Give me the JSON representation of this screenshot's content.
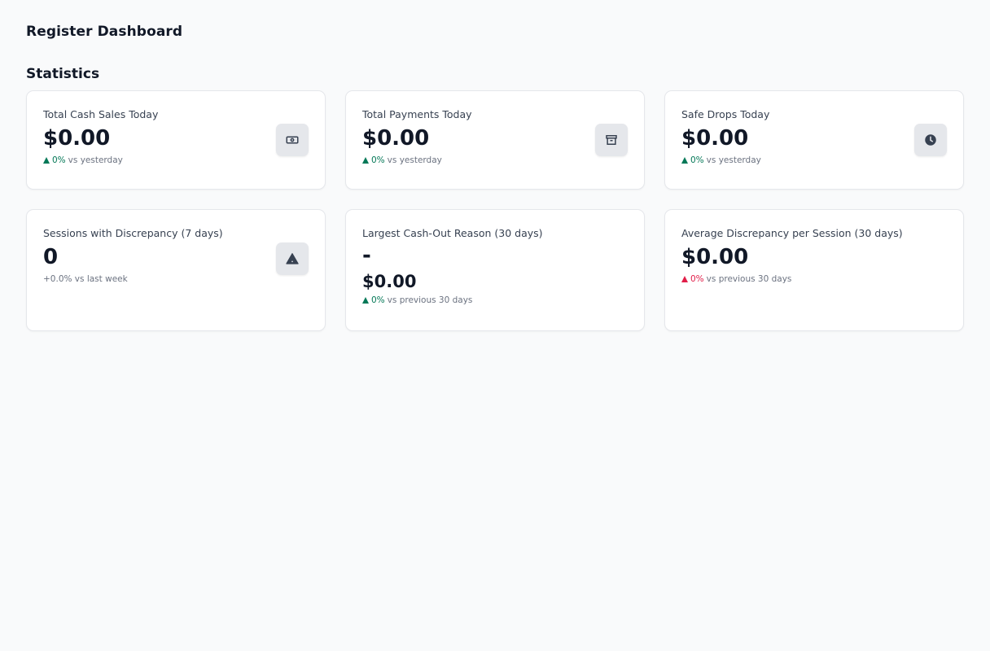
{
  "page": {
    "title": "Register Dashboard"
  },
  "statistics": {
    "section_title": "Statistics",
    "cards": [
      {
        "label": "Total Cash Sales Today",
        "value": "$0.00",
        "delta_pct": "0%",
        "delta_text": "vs yesterday",
        "trend": "up",
        "icon": "cash-icon"
      },
      {
        "label": "Total Payments Today",
        "value": "$0.00",
        "delta_pct": "0%",
        "delta_text": "vs yesterday",
        "trend": "up",
        "icon": "archive-icon"
      },
      {
        "label": "Safe Drops Today",
        "value": "$0.00",
        "delta_pct": "0%",
        "delta_text": "vs yesterday",
        "trend": "up",
        "icon": "clock-icon"
      },
      {
        "label": "Sessions with Discrepancy (7 days)",
        "value": "0",
        "delta_text": "+0.0% vs last week",
        "icon": "warning-icon"
      },
      {
        "label": "Largest Cash-Out Reason (30 days)",
        "reason": "-",
        "value": "$0.00",
        "delta_pct": "0%",
        "delta_text": "vs previous 30 days",
        "trend": "up"
      },
      {
        "label": "Average Discrepancy per Session (30 days)",
        "value": "$0.00",
        "delta_pct": "0%",
        "delta_text": "vs previous 30 days",
        "trend": "up-negative"
      }
    ]
  },
  "colors": {
    "positive": "#047857",
    "negative": "#e11d48",
    "background": "#f9fafb",
    "card_border": "#e5e7eb",
    "icon_bg": "#e5e7eb",
    "icon_fg": "#374151"
  }
}
